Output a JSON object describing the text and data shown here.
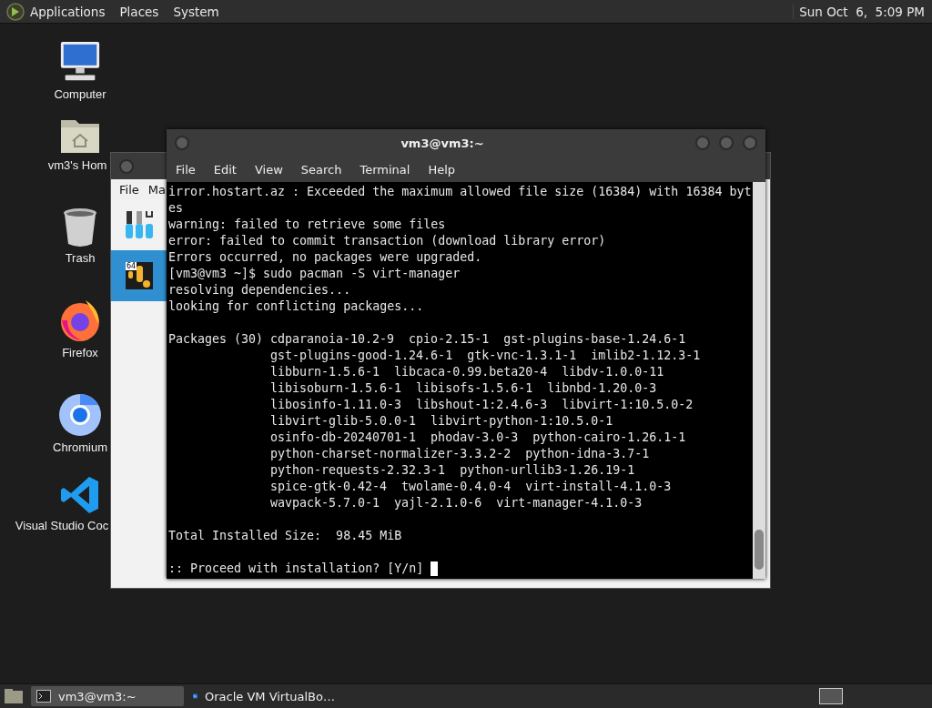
{
  "top_panel": {
    "menus": [
      "Applications",
      "Places",
      "System"
    ],
    "clock": "Sun Oct  6,  5:09 PM"
  },
  "desktop_icons": [
    {
      "kind": "computer",
      "label": "Computer"
    },
    {
      "kind": "home",
      "label": "vm3's Hom"
    },
    {
      "kind": "trash",
      "label": "Trash"
    },
    {
      "kind": "firefox",
      "label": "Firefox"
    },
    {
      "kind": "chromium",
      "label": "Chromium"
    },
    {
      "kind": "vscode",
      "label": "Visual Studio Coc"
    }
  ],
  "back_window": {
    "menus": [
      "File",
      "Ma"
    ],
    "items": [
      {
        "kind": "tools",
        "selected": false
      },
      {
        "kind": "vm",
        "selected": true,
        "badge": "64"
      }
    ]
  },
  "terminal": {
    "title": "vm3@vm3:~",
    "menus": [
      "File",
      "Edit",
      "View",
      "Search",
      "Terminal",
      "Help"
    ],
    "lines": [
      "irror.hostart.az : Exceeded the maximum allowed file size (16384) with 16384 byt",
      "es",
      "warning: failed to retrieve some files",
      "error: failed to commit transaction (download library error)",
      "Errors occurred, no packages were upgraded.",
      "[vm3@vm3 ~]$ sudo pacman -S virt-manager",
      "resolving dependencies...",
      "looking for conflicting packages..."
    ],
    "packages_label": "Packages (30)",
    "packages": [
      "cdparanoia-10.2-9  cpio-2.15-1  gst-plugins-base-1.24.6-1",
      "gst-plugins-good-1.24.6-1  gtk-vnc-1.3.1-1  imlib2-1.12.3-1",
      "libburn-1.5.6-1  libcaca-0.99.beta20-4  libdv-1.0.0-11",
      "libisoburn-1.5.6-1  libisofs-1.5.6-1  libnbd-1.20.0-3",
      "libosinfo-1.11.0-3  libshout-1:2.4.6-3  libvirt-1:10.5.0-2",
      "libvirt-glib-5.0.0-1  libvirt-python-1:10.5.0-1",
      "osinfo-db-20240701-1  phodav-3.0-3  python-cairo-1.26.1-1",
      "python-charset-normalizer-3.3.2-2  python-idna-3.7-1",
      "python-requests-2.32.3-1  python-urllib3-1.26.19-1",
      "spice-gtk-0.42-4  twolame-0.4.0-4  virt-install-4.1.0-3",
      "wavpack-5.7.0-1  yajl-2.1.0-6  virt-manager-4.1.0-3"
    ],
    "total": "Total Installed Size:  98.45 MiB",
    "prompt": ":: Proceed with installation? [Y/n]"
  },
  "taskbar": {
    "items": [
      {
        "kind": "terminal",
        "label": "vm3@vm3:~",
        "selected": true
      },
      {
        "kind": "virtualbox",
        "label": "Oracle VM VirtualBo…",
        "selected": false
      }
    ]
  }
}
